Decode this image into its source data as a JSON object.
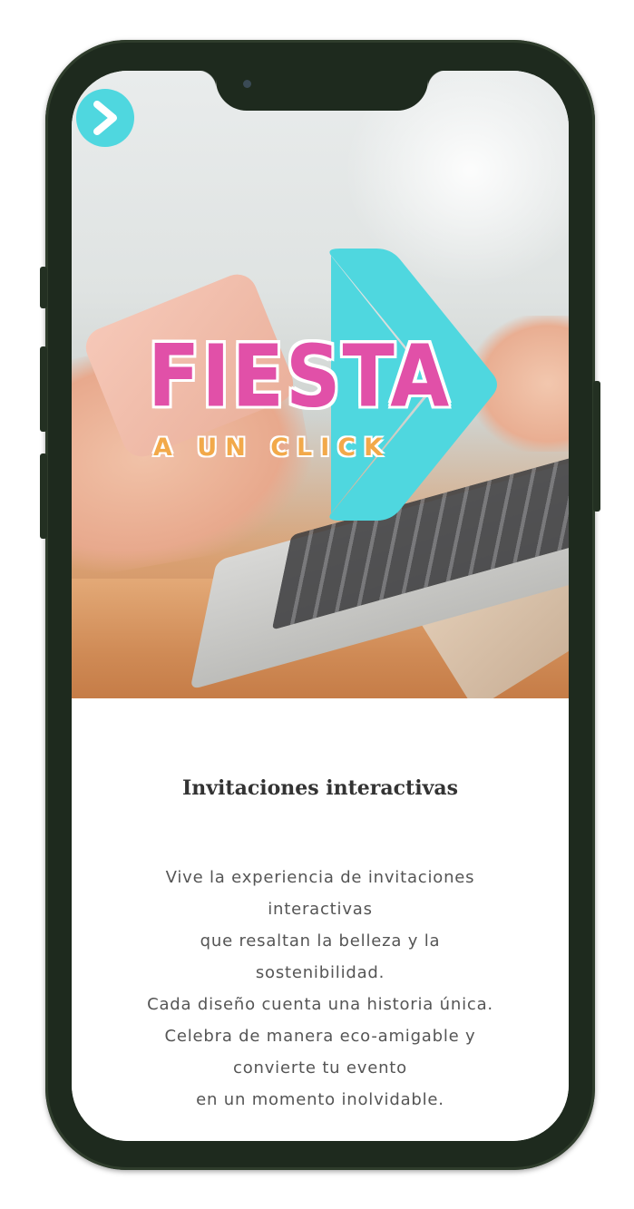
{
  "logo": {
    "word": "FIESTA",
    "tagline": "A UN CLICK"
  },
  "nav": {
    "icon": "chevron-right-icon"
  },
  "section": {
    "title": "Invitaciones interactivas",
    "lines": [
      "Vive la experiencia de invitaciones",
      "interactivas",
      "que resaltan la belleza y la",
      "sostenibilidad.",
      "Cada diseño cuenta una historia única.",
      "Celebra de manera eco-amigable y",
      "convierte tu evento",
      "en un momento inolvidable."
    ]
  },
  "colors": {
    "accent_cyan": "#4fd7df",
    "logo_pink": "#e150a8",
    "logo_orange": "#f2a94a",
    "phone_frame": "#1e2a1e"
  }
}
